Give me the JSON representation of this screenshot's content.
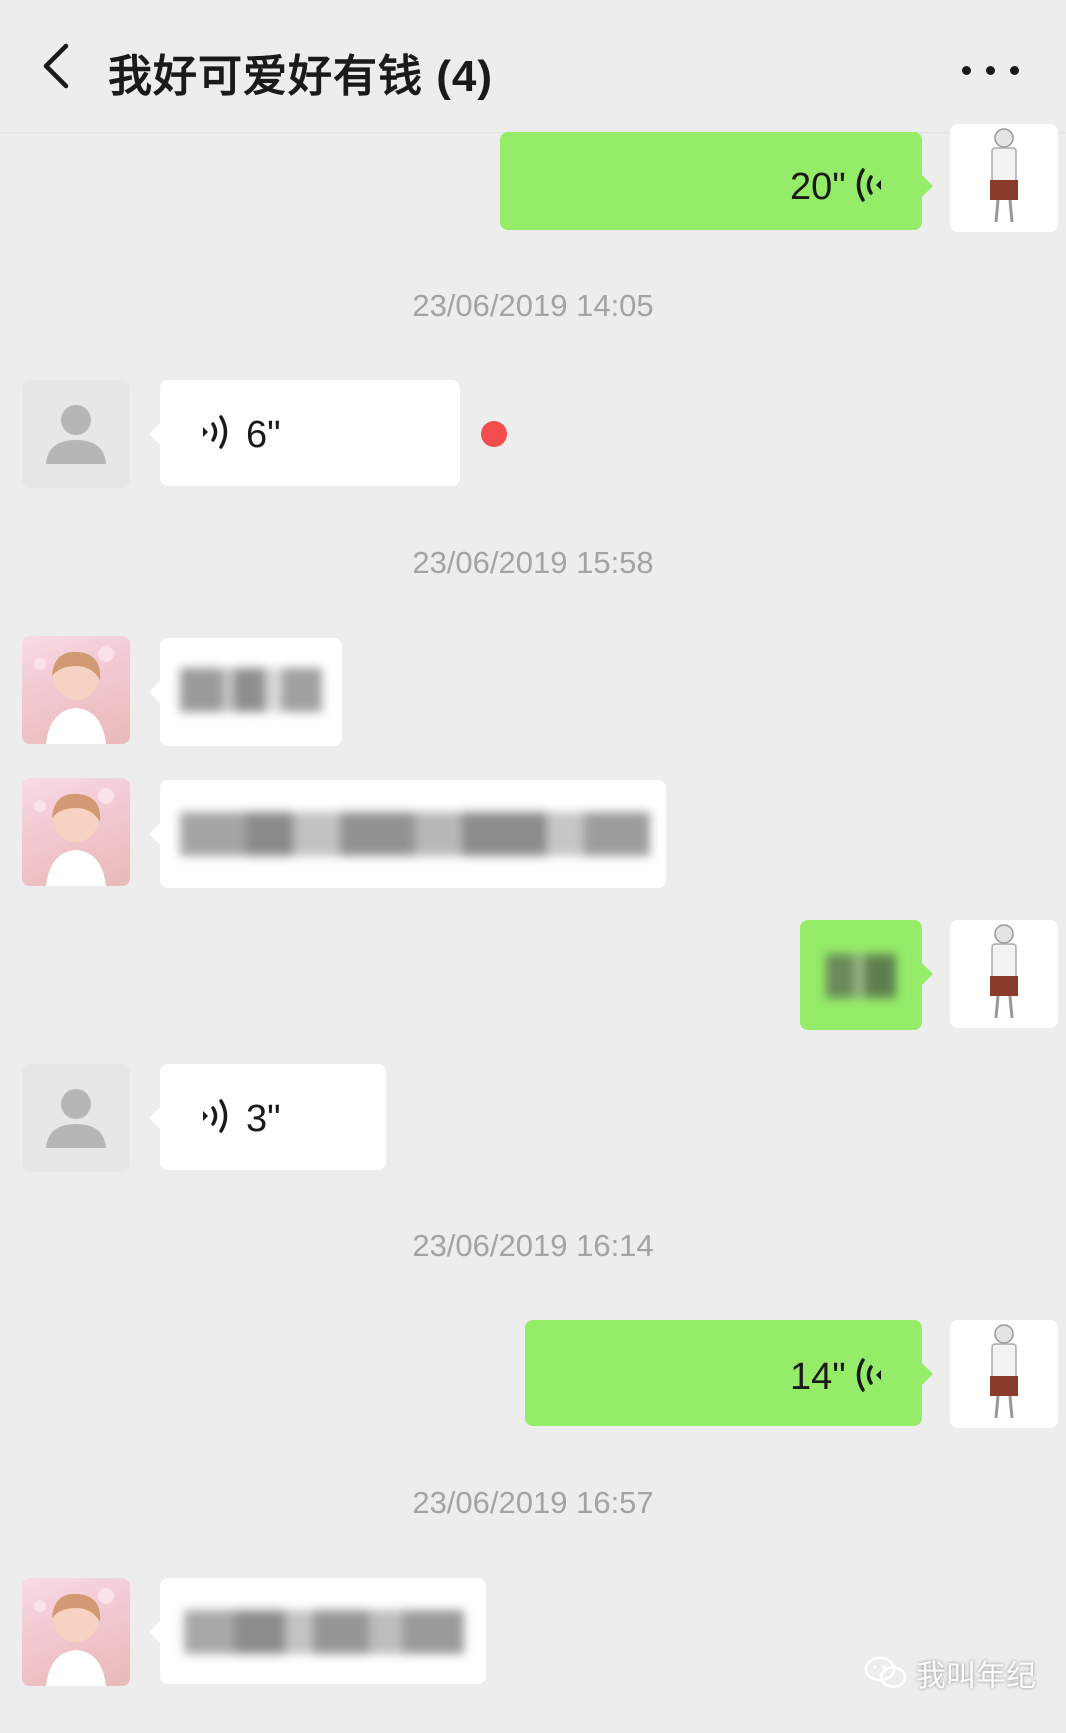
{
  "header": {
    "back_icon": "chevron-left-icon",
    "title": "我好可爱好有钱 (4)",
    "more_icon": "more-dots-icon"
  },
  "messages": [
    {
      "side": "right",
      "type": "voice",
      "duration": "20\""
    },
    {
      "type": "timestamp",
      "text": "23/06/2019 14:05"
    },
    {
      "side": "left",
      "type": "voice",
      "duration": "6\"",
      "unread": true
    },
    {
      "type": "timestamp",
      "text": "23/06/2019 15:58"
    },
    {
      "side": "left",
      "type": "text",
      "content": "blurred"
    },
    {
      "side": "left",
      "type": "text",
      "content": "blurred"
    },
    {
      "side": "right",
      "type": "text",
      "content": "blurred"
    },
    {
      "side": "left",
      "type": "voice",
      "duration": "3\""
    },
    {
      "type": "timestamp",
      "text": "23/06/2019 16:14"
    },
    {
      "side": "right",
      "type": "voice",
      "duration": "14\""
    },
    {
      "type": "timestamp",
      "text": "23/06/2019 16:57"
    },
    {
      "side": "left",
      "type": "text",
      "content": "blurred"
    }
  ],
  "colors": {
    "background": "#ededed",
    "bubble_self": "#95ec69",
    "bubble_other": "#ffffff",
    "timestamp": "#a3a3a3",
    "unread_dot": "#f34d4d"
  },
  "watermark": {
    "icon": "wechat-icon",
    "text": "我叫年纪"
  }
}
